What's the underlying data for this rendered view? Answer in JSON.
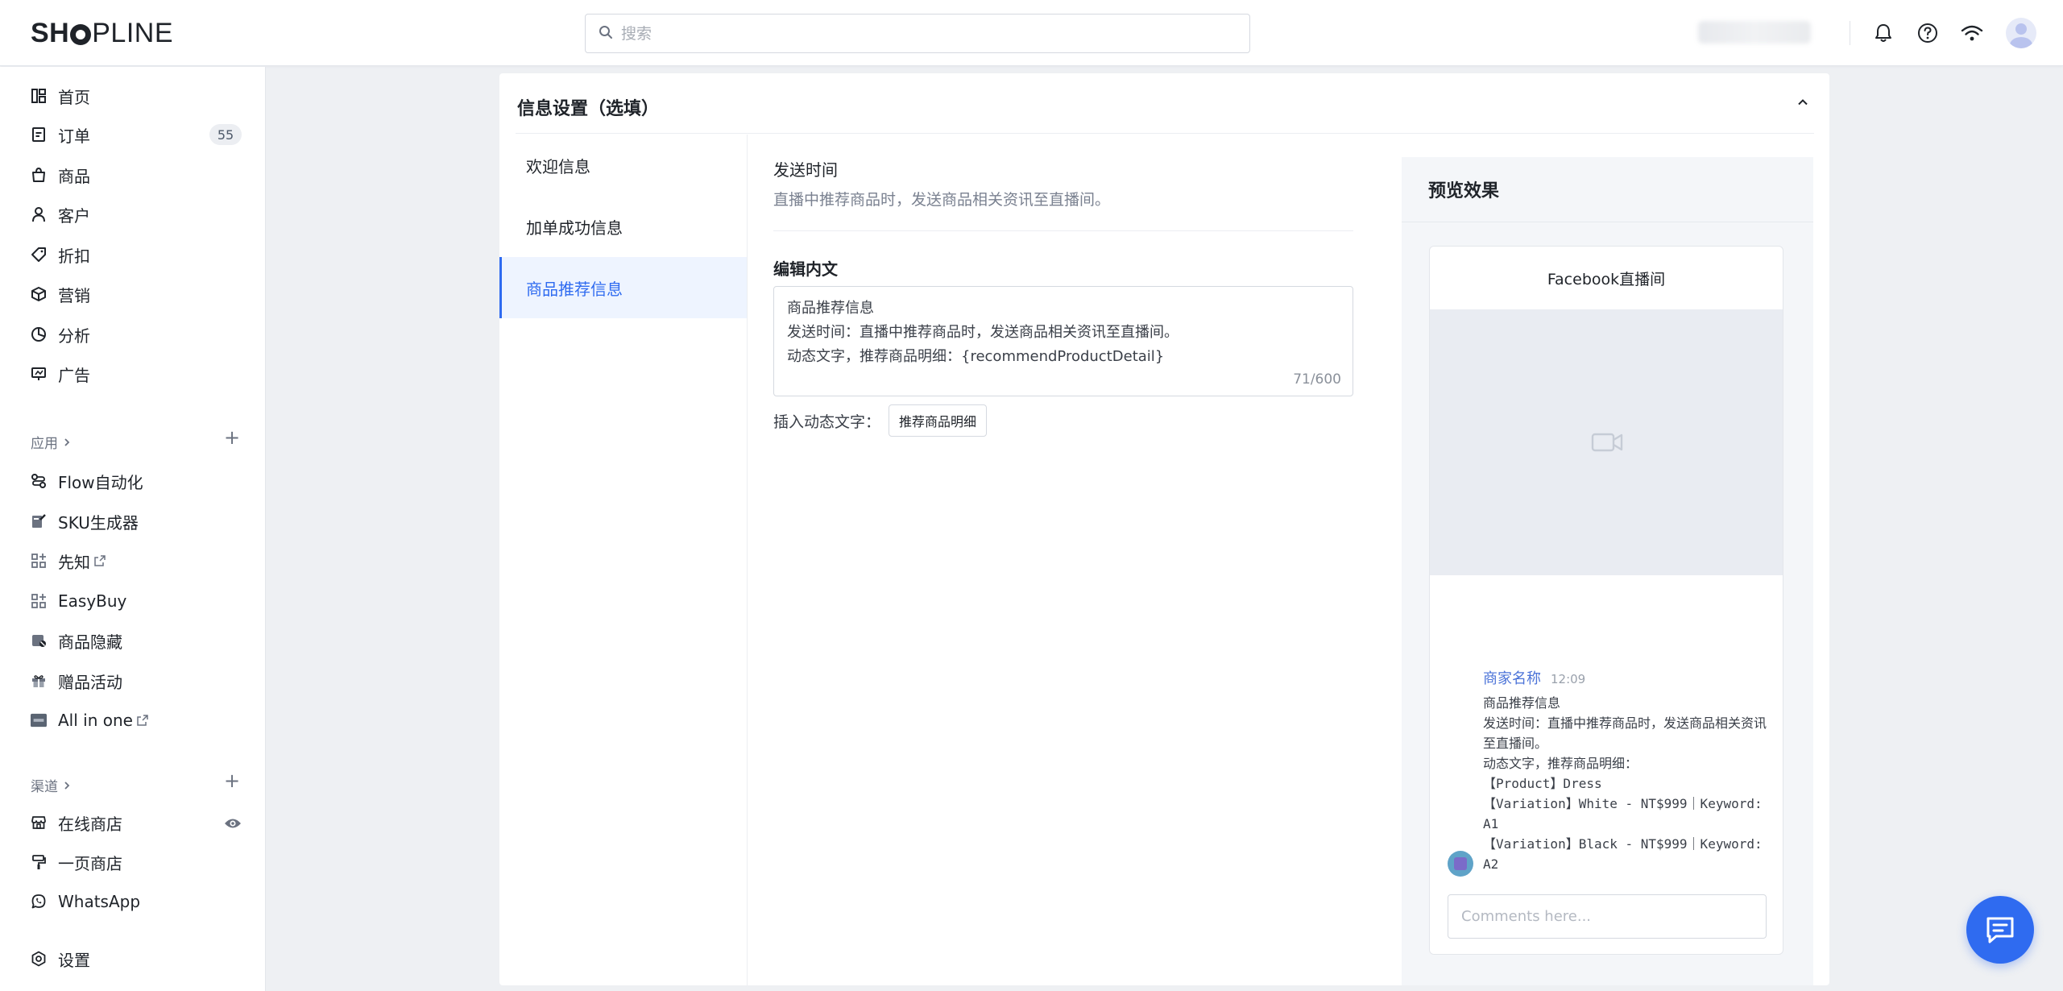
{
  "brand": {
    "logo_prefix": "SH",
    "logo_suffix": "PLINE",
    "accent": "#2f6bf0"
  },
  "header": {
    "search_placeholder": "搜索"
  },
  "sidebar": {
    "main_items": [
      {
        "label": "首页",
        "icon": "dashboard-icon"
      },
      {
        "label": "订单",
        "icon": "order-icon",
        "badge": "55"
      },
      {
        "label": "商品",
        "icon": "bag-icon"
      },
      {
        "label": "客户",
        "icon": "user-icon"
      },
      {
        "label": "折扣",
        "icon": "tag-icon"
      },
      {
        "label": "营销",
        "icon": "cube-icon"
      },
      {
        "label": "分析",
        "icon": "pie-icon"
      },
      {
        "label": "广告",
        "icon": "ad-icon"
      }
    ],
    "apps_title": "应用",
    "apps": [
      {
        "label": "Flow自动化",
        "icon": "flow-icon"
      },
      {
        "label": "SKU生成器",
        "icon": "sku-icon"
      },
      {
        "label": "先知",
        "icon": "app-grid-icon",
        "external": true
      },
      {
        "label": "EasyBuy",
        "icon": "app-grid-icon"
      },
      {
        "label": "商品隐藏",
        "icon": "hide-product-icon"
      },
      {
        "label": "赠品活动",
        "icon": "gift-icon"
      },
      {
        "label": "All in one",
        "icon": "all-in-one-icon",
        "external": true
      }
    ],
    "channels_title": "渠道",
    "channels": [
      {
        "label": "在线商店",
        "icon": "store-icon"
      },
      {
        "label": "一页商店",
        "icon": "brush-icon"
      },
      {
        "label": "WhatsApp",
        "icon": "whatsapp-icon"
      }
    ],
    "settings_label": "设置"
  },
  "card": {
    "title": "信息设置（选填）",
    "tabs": [
      "欢迎信息",
      "加单成功信息",
      "商品推荐信息"
    ],
    "active_tab": 2
  },
  "form": {
    "send_time_label": "发送时间",
    "send_time_desc": "直播中推荐商品时，发送商品相关资讯至直播间。",
    "edit_label": "编辑内文",
    "editor_lines": [
      "商品推荐信息",
      "发送时间：直播中推荐商品时，发送商品相关资讯至直播间。",
      "动态文字，推荐商品明细：{recommendProductDetail}"
    ],
    "counter": "71/600",
    "insert_label": "插入动态文字：",
    "insert_button": "推荐商品明细"
  },
  "preview": {
    "title": "预览效果",
    "channel_title": "Facebook直播间",
    "merchant_name": "商家名称",
    "time": "12:09",
    "message": "商品推荐信息\n发送时间：直播中推荐商品时，发送商品相关资讯至直播间。\n动态文字，推荐商品明细：\n【Product】Dress\n【Variation】White - NT$999｜Keyword: A1\n【Variation】Black - NT$999｜Keyword: A2",
    "comment_placeholder": "Comments here..."
  }
}
